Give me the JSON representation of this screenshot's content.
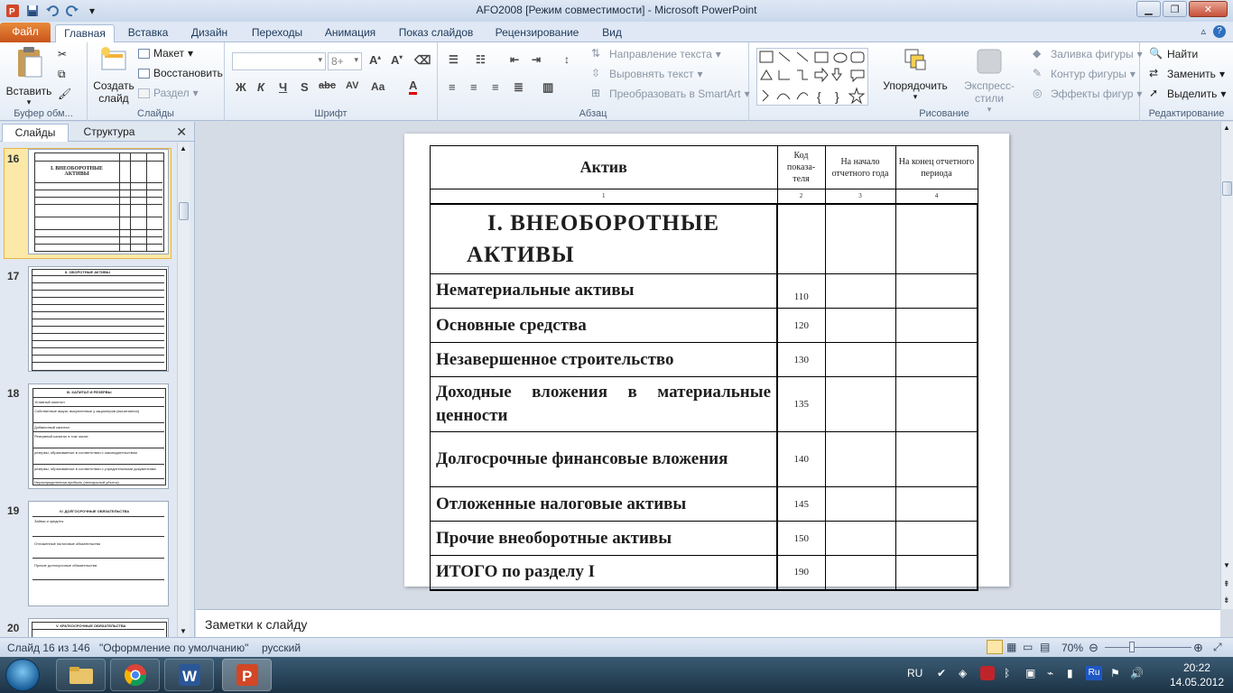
{
  "window": {
    "title": "AFO2008 [Режим совместимости]  -  Microsoft PowerPoint"
  },
  "tabs": {
    "file": "Файл",
    "items": [
      "Главная",
      "Вставка",
      "Дизайн",
      "Переходы",
      "Анимация",
      "Показ слайдов",
      "Рецензирование",
      "Вид"
    ]
  },
  "ribbon": {
    "clipboard": {
      "paste": "Вставить",
      "label": "Буфер обм..."
    },
    "slides": {
      "new_slide_1": "Создать",
      "new_slide_2": "слайд",
      "layout": "Макет",
      "reset": "Восстановить",
      "section": "Раздел",
      "label": "Слайды"
    },
    "font": {
      "size": "8+",
      "label": "Шрифт"
    },
    "paragraph": {
      "text_direction": "Направление текста",
      "align_text": "Выровнять текст",
      "smartart": "Преобразовать в SmartArt",
      "label": "Абзац"
    },
    "drawing": {
      "arrange": "Упорядочить",
      "quick_styles": "Экспресс-стили",
      "fill": "Заливка фигуры",
      "outline": "Контур фигуры",
      "effects": "Эффекты фигур",
      "label": "Рисование"
    },
    "editing": {
      "find": "Найти",
      "replace": "Заменить",
      "select": "Выделить",
      "label": "Редактирование"
    }
  },
  "left_panel": {
    "tab_slides": "Слайды",
    "tab_outline": "Структура",
    "thumbs": [
      {
        "num": "16",
        "title": "I. ВНЕОБОРОТНЫЕ АКТИВЫ"
      },
      {
        "num": "17",
        "title": "II. ОБОРОТНЫЕ АКТИВЫ"
      },
      {
        "num": "18",
        "title": "III. КАПИТАЛ И РЕЗЕРВЫ"
      },
      {
        "num": "19",
        "title": "IV. ДОЛГОСРОЧНЫЕ ОБЯЗАТЕЛЬСТВА"
      },
      {
        "num": "20",
        "title": "V. КРАТКОСРОЧНЫЕ ОБЯЗАТЕЛЬСТВА"
      }
    ],
    "thumb19_lines": [
      "Займы и кредиты",
      "Отложенные налоговые обязательства",
      "Прочие долгосрочные обязательства"
    ],
    "thumb18_lines": [
      "Уставный капитал",
      "Собственные акции, выкупленные у акционеров (вычитаются)",
      "Добавочный капитал",
      "Резервный капитал в том числе:",
      "резервы, образованные в соответствии с законодательством",
      "резервы, образованные в соответствии с учредительными документами",
      "Нераспределенная прибыль (непокрытый убыток)"
    ]
  },
  "slide": {
    "headers": {
      "asset": "Актив",
      "code": "Код показа-теля",
      "begin": "На начало отчетного года",
      "end": "На конец отчетного периода"
    },
    "col_numbers": [
      "1",
      "2",
      "3",
      "4"
    ],
    "section_title": "I.  ВНЕОБОРОТНЫЕ АКТИВЫ",
    "rows": [
      {
        "name": "Нематериальные  активы",
        "code": "110"
      },
      {
        "name": "Основные  средства",
        "code": "120"
      },
      {
        "name": "Незавершенное  строительство",
        "code": "130"
      },
      {
        "name": "Доходные  вложения  в материальные  ценности",
        "code": "135"
      },
      {
        "name": "Долгосрочные  финансовые вложения",
        "code": "140"
      },
      {
        "name": "Отложенные  налоговые  активы",
        "code": "145"
      },
      {
        "name": "Прочие  внеоборотные  активы",
        "code": "150"
      },
      {
        "name": "ИТОГО  по разделу I",
        "code": "190"
      }
    ]
  },
  "notes": {
    "placeholder": "Заметки к слайду"
  },
  "status": {
    "slide_counter": "Слайд 16 из 146",
    "theme": "\"Оформление по умолчанию\"",
    "language": "русский",
    "zoom": "70%"
  },
  "taskbar": {
    "lang": "RU",
    "time": "20:22",
    "date": "14.05.2012"
  }
}
